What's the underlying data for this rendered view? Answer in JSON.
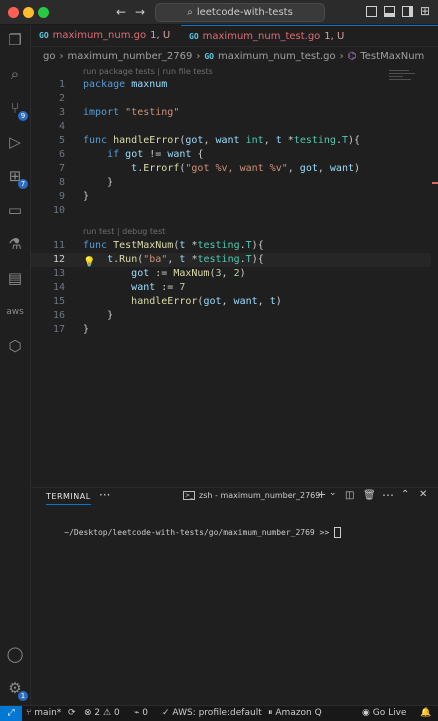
{
  "window": {
    "search_text": "leetcode-with-tests",
    "traffic_lights": [
      "#ff5f57",
      "#febc2e",
      "#28c840"
    ]
  },
  "activity_bar": {
    "items": [
      {
        "name": "explorer",
        "icon": "files-icon"
      },
      {
        "name": "search",
        "icon": "search-icon"
      },
      {
        "name": "source-control",
        "icon": "source-control-icon",
        "badge": "9"
      },
      {
        "name": "run-debug",
        "icon": "debug-icon"
      },
      {
        "name": "extensions",
        "icon": "extensions-icon",
        "badge": "7"
      },
      {
        "name": "remote",
        "icon": "remote-icon"
      },
      {
        "name": "testing",
        "icon": "flask-icon"
      },
      {
        "name": "docker",
        "icon": "docker-icon"
      },
      {
        "name": "aws",
        "icon": "aws-icon",
        "label": "aws"
      },
      {
        "name": "amazon-q",
        "icon": "amazon-q-icon"
      }
    ],
    "bottom": [
      {
        "name": "accounts",
        "icon": "account-icon"
      },
      {
        "name": "manage",
        "icon": "gear-icon",
        "badge": "1"
      }
    ]
  },
  "tabs": [
    {
      "label": "maximum_num.go",
      "status": "1, U",
      "active": false
    },
    {
      "label": "maximum_num_test.go",
      "status": "1, U",
      "active": true
    }
  ],
  "breadcrumb": [
    "go",
    "maximum_number_2769",
    "maximum_num_test.go",
    "TestMaxNum"
  ],
  "editor": {
    "codelens_package": "run package tests | run file tests",
    "codelens_test": "run test | debug test",
    "active_line": 12,
    "lines": [
      {
        "n": "1",
        "text": "package maxnum"
      },
      {
        "n": "2",
        "text": ""
      },
      {
        "n": "3",
        "text": "import \"testing\""
      },
      {
        "n": "4",
        "text": ""
      },
      {
        "n": "5",
        "text": "func handleError(got, want int, t *testing.T){"
      },
      {
        "n": "6",
        "text": "    if got != want {"
      },
      {
        "n": "7",
        "text": "        t.Errorf(\"got %v, want %v\", got, want)"
      },
      {
        "n": "8",
        "text": "    }"
      },
      {
        "n": "9",
        "text": "}"
      },
      {
        "n": "10",
        "text": ""
      },
      {
        "n": "11",
        "text": "func TestMaxNum(t *testing.T){"
      },
      {
        "n": "12",
        "text": "    t.Run(\"ba\", t *testing.T){"
      },
      {
        "n": "13",
        "text": "        got := MaxNum(3, 2)"
      },
      {
        "n": "14",
        "text": "        want := 7"
      },
      {
        "n": "15",
        "text": "        handleError(got, want, t)"
      },
      {
        "n": "16",
        "text": "    }"
      },
      {
        "n": "17",
        "text": "}"
      }
    ]
  },
  "panel": {
    "tab_label": "TERMINAL",
    "more": "···",
    "terminal_name": "zsh - maximum_number_2769",
    "prompt": "~/Desktop/leetcode-with-tests/go/maximum_number_2769 >> "
  },
  "status_bar": {
    "branch": "main*",
    "errors": "2",
    "warnings": "0",
    "ports": "0",
    "aws": "AWS: profile:default",
    "amazon_q": "Amazon Q",
    "go_live": "Go Live"
  }
}
